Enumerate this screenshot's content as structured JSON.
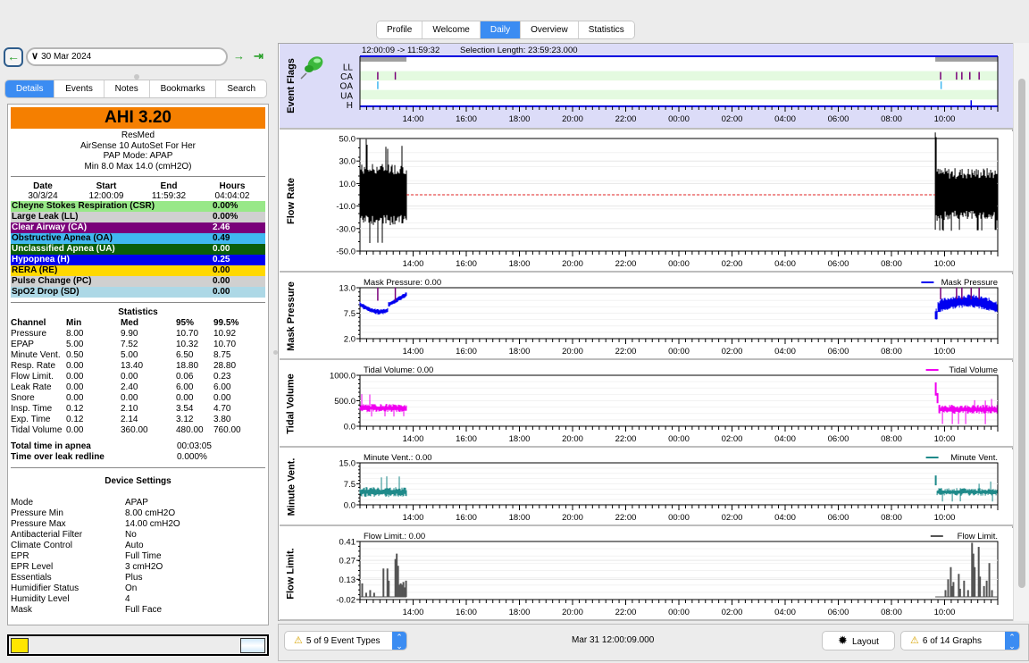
{
  "top_tabs": [
    {
      "label": "Profile",
      "active": false
    },
    {
      "label": "Welcome",
      "active": false
    },
    {
      "label": "Daily",
      "active": true
    },
    {
      "label": "Overview",
      "active": false
    },
    {
      "label": "Statistics",
      "active": false
    }
  ],
  "nav": {
    "back_icon": "arrow-left-icon",
    "date": "30 Mar 2024",
    "forward_icon": "arrow-right-icon",
    "last_icon": "arrow-right-end-icon"
  },
  "left_tabs": [
    {
      "label": "Details",
      "active": true
    },
    {
      "label": "Events",
      "active": false
    },
    {
      "label": "Notes",
      "active": false
    },
    {
      "label": "Bookmarks",
      "active": false
    },
    {
      "label": "Search",
      "active": false
    }
  ],
  "details": {
    "ahi_label": "AHI  3.20",
    "ahi_color": "#f57f00",
    "manufacturer": "ResMed",
    "model": "AirSense 10 AutoSet For Her",
    "mode": "PAP Mode: APAP",
    "pressure": "Min 8.0 Max 14.0 (cmH2O)",
    "session_headers": [
      "Date",
      "Start",
      "End",
      "Hours"
    ],
    "session_values": [
      "30/3/24",
      "12:00:09",
      "11:59:32",
      "04:04:02"
    ],
    "events": [
      {
        "name": "Cheyne Stokes Respiration (CSR)",
        "value": "0.00%",
        "bg": "#98e888",
        "fg": "#000"
      },
      {
        "name": "Large Leak (LL)",
        "value": "0.00%",
        "bg": "#d0d0d0",
        "fg": "#000"
      },
      {
        "name": "Clear Airway (CA)",
        "value": "2.46",
        "bg": "#7a007a",
        "fg": "#fff"
      },
      {
        "name": "Obstructive Apnea (OA)",
        "value": "0.49",
        "bg": "#40b8f0",
        "fg": "#000"
      },
      {
        "name": "Unclassified Apnea (UA)",
        "value": "0.00",
        "bg": "#0a5e0a",
        "fg": "#fff"
      },
      {
        "name": "Hypopnea (H)",
        "value": "0.25",
        "bg": "#0000f0",
        "fg": "#fff"
      },
      {
        "name": "RERA (RE)",
        "value": "0.00",
        "bg": "#ffd800",
        "fg": "#000"
      },
      {
        "name": "Pulse Change (PC)",
        "value": "0.00",
        "bg": "#d0d0d0",
        "fg": "#000"
      },
      {
        "name": "SpO2 Drop (SD)",
        "value": "0.00",
        "bg": "#add8e6",
        "fg": "#000"
      }
    ],
    "statistics_title": "Statistics",
    "stat_headers": [
      "Channel",
      "Min",
      "Med",
      "95%",
      "99.5%"
    ],
    "stat_rows": [
      [
        "Pressure",
        "8.00",
        "9.90",
        "10.70",
        "10.92"
      ],
      [
        "EPAP",
        "5.00",
        "7.52",
        "10.32",
        "10.70"
      ],
      [
        "Minute Vent.",
        "0.50",
        "5.00",
        "6.50",
        "8.75"
      ],
      [
        "Resp. Rate",
        "0.00",
        "13.40",
        "18.80",
        "28.80"
      ],
      [
        "Flow Limit.",
        "0.00",
        "0.00",
        "0.06",
        "0.23"
      ],
      [
        "Leak Rate",
        "0.00",
        "2.40",
        "6.00",
        "6.00"
      ],
      [
        "Snore",
        "0.00",
        "0.00",
        "0.00",
        "0.00"
      ],
      [
        "Insp. Time",
        "0.12",
        "2.10",
        "3.54",
        "4.70"
      ],
      [
        "Exp. Time",
        "0.12",
        "2.14",
        "3.12",
        "3.80"
      ],
      [
        "Tidal Volume",
        "0.00",
        "360.00",
        "480.00",
        "760.00"
      ]
    ],
    "apnea_time_label": "Total time in apnea",
    "apnea_time_value": "00:03:05",
    "leak_label": "Time over leak redline",
    "leak_value": "0.000%",
    "device_settings_title": "Device Settings",
    "device_settings": [
      [
        "Mode",
        "APAP"
      ],
      [
        "Pressure Min",
        "8.00 cmH2O"
      ],
      [
        "Pressure Max",
        "14.00 cmH2O"
      ],
      [
        "Antibacterial Filter",
        "No"
      ],
      [
        "Climate Control",
        "Auto"
      ],
      [
        "EPR",
        "Full Time"
      ],
      [
        "EPR Level",
        "3 cmH2O"
      ],
      [
        "Essentials",
        "Plus"
      ],
      [
        "Humidifier Status",
        "On"
      ],
      [
        "Humidity Level",
        "4"
      ],
      [
        "Mask",
        "Full Face"
      ]
    ]
  },
  "bottom": {
    "event_types": "5 of 9 Event Types",
    "datetime": "Mar 31 12:00:09.000",
    "layout": "Layout",
    "graphs": "6 of 14 Graphs"
  },
  "chart_data": [
    {
      "type": "event-flags",
      "title": "Event Flags",
      "header_range": "12:00:09 -> 11:59:32",
      "header_selection": "Selection Length: 23:59:23.000",
      "rows": [
        "LL",
        "CA",
        "OA",
        "UA",
        "H"
      ],
      "x_ticks": [
        "14:00",
        "16:00",
        "18:00",
        "20:00",
        "22:00",
        "00:00",
        "02:00",
        "04:00",
        "06:00",
        "08:00",
        "10:00"
      ],
      "x_range_hours": [
        12.0,
        36.0
      ],
      "sessions_hours": [
        [
          12.0,
          13.75
        ],
        [
          33.65,
          36.0
        ]
      ],
      "events": {
        "CA": [
          12.67,
          13.33,
          33.85,
          34.45,
          34.65,
          34.95,
          35.3
        ],
        "OA": [
          12.67,
          33.87
        ],
        "H": [
          35.0
        ]
      },
      "colors": {
        "CA": "#7a007a",
        "OA": "#40b8f0",
        "H": "#0000f0"
      }
    },
    {
      "type": "line",
      "title": "Flow Rate",
      "ylim": [
        -50,
        50
      ],
      "y_ticks": [
        "50.0",
        "30.0",
        "10.0",
        "-10.0",
        "-30.0",
        "-50.0"
      ],
      "color": "#000000",
      "legend": "",
      "header": "",
      "sessions_hours": [
        [
          12.0,
          13.75
        ],
        [
          33.65,
          36.0
        ]
      ],
      "typical_band": [
        -25,
        25
      ],
      "spike_range": [
        -42,
        50
      ],
      "redline": 0,
      "redline_color": "#e02020"
    },
    {
      "type": "line",
      "title": "Mask Pressure",
      "ylim": [
        2,
        13
      ],
      "y_ticks": [
        "13.0",
        "7.5",
        "2.0"
      ],
      "color": "#0000f0",
      "legend": "Mask Pressure",
      "header": "Mask Pressure: 0.00",
      "sessions_hours": [
        [
          12.0,
          13.75
        ],
        [
          33.65,
          36.0
        ]
      ],
      "session1_approx": [
        9.5,
        8.2,
        9.0,
        10.0,
        9.8
      ],
      "session2_approx": [
        7.0,
        10.2,
        10.5,
        9.8,
        8.5
      ]
    },
    {
      "type": "line",
      "title": "Tidal Volume",
      "ylim": [
        0,
        1000
      ],
      "y_ticks": [
        "1000.0",
        "500.0",
        "0.0"
      ],
      "color": "#f000f0",
      "legend": "Tidal Volume",
      "header": "Tidal Volume: 0.00",
      "sessions_hours": [
        [
          12.0,
          13.75
        ],
        [
          33.65,
          36.0
        ]
      ],
      "typical": 370,
      "max": 760
    },
    {
      "type": "line",
      "title": "Minute Vent.",
      "ylim": [
        0,
        15
      ],
      "y_ticks": [
        "15.0",
        "7.5",
        "0.0"
      ],
      "color": "#1f8a8a",
      "legend": "Minute Vent.",
      "header": "Minute Vent.: 0.00",
      "sessions_hours": [
        [
          12.0,
          13.75
        ],
        [
          33.65,
          36.0
        ]
      ],
      "typical": 5.0,
      "max": 10.5
    },
    {
      "type": "bar",
      "title": "Flow Limit.",
      "ylim": [
        -0.02,
        0.41
      ],
      "y_ticks": [
        "0.41",
        "0.27",
        "0.13",
        "-0.02"
      ],
      "color": "#555555",
      "legend": "Flow Limit.",
      "header": "Flow Limit.: 0.00",
      "sessions_hours": [
        [
          12.0,
          13.75
        ],
        [
          33.65,
          36.0
        ]
      ],
      "max": 0.38
    }
  ]
}
